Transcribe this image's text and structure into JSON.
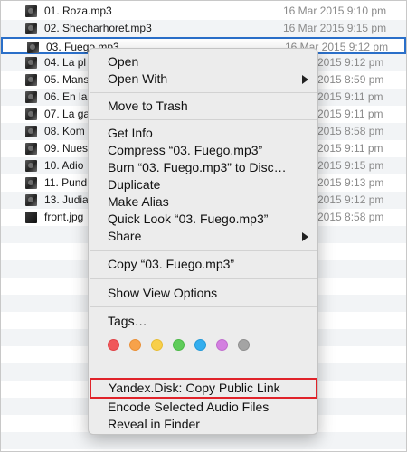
{
  "files": [
    {
      "name": "01. Roza.mp3",
      "date": "16 Mar 2015 9:10 pm",
      "icon": "audio-file-icon"
    },
    {
      "name": "02. Shecharhoret.mp3",
      "date": "16 Mar 2015 9:15 pm",
      "icon": "audio-file-icon"
    },
    {
      "name": "03. Fuego.mp3",
      "date": "16 Mar 2015 9:12 pm",
      "icon": "audio-file-icon"
    },
    {
      "name": "04. La pl",
      "date": "2015 9:12 pm",
      "icon": "audio-file-icon"
    },
    {
      "name": "05. Mans",
      "date": "2015 8:59 pm",
      "icon": "audio-file-icon"
    },
    {
      "name": "06. En la",
      "date": "2015 9:11 pm",
      "icon": "audio-file-icon"
    },
    {
      "name": "07. La ga",
      "date": "2015 9:11 pm",
      "icon": "audio-file-icon"
    },
    {
      "name": "08. Kom",
      "date": "2015 8:58 pm",
      "icon": "audio-file-icon"
    },
    {
      "name": "09. Nues",
      "date": "2015 9:11 pm",
      "icon": "audio-file-icon"
    },
    {
      "name": "10. Adio",
      "date": "2015 9:15 pm",
      "icon": "audio-file-icon"
    },
    {
      "name": "11. Pund",
      "date": "2015 9:13 pm",
      "icon": "audio-file-icon"
    },
    {
      "name": "13. Judia",
      "date": "2015 9:12 pm",
      "icon": "audio-file-icon"
    },
    {
      "name": "front.jpg",
      "date": "2015 8:58 pm",
      "icon": "image-file-icon"
    }
  ],
  "selected_index": 2,
  "menu": {
    "open": "Open",
    "open_with": "Open With",
    "move_to_trash": "Move to Trash",
    "get_info": "Get Info",
    "compress": "Compress “03. Fuego.mp3”",
    "burn": "Burn “03. Fuego.mp3” to Disc…",
    "duplicate": "Duplicate",
    "make_alias": "Make Alias",
    "quick_look": "Quick Look “03. Fuego.mp3”",
    "share": "Share",
    "copy": "Copy “03. Fuego.mp3”",
    "show_view_options": "Show View Options",
    "tags": "Tags…",
    "yandex_copy_link": "Yandex.Disk: Copy Public Link",
    "encode_audio": "Encode Selected Audio Files",
    "reveal_in_finder": "Reveal in Finder"
  },
  "tag_colors": [
    {
      "name": "red",
      "fill": "#f0575a",
      "border": "#e04448"
    },
    {
      "name": "orange",
      "fill": "#f7a24a",
      "border": "#ea9037"
    },
    {
      "name": "yellow",
      "fill": "#f8cf4a",
      "border": "#e8bd34"
    },
    {
      "name": "green",
      "fill": "#5fcc5a",
      "border": "#4cb948"
    },
    {
      "name": "blue",
      "fill": "#34aeee",
      "border": "#2399d8"
    },
    {
      "name": "purple",
      "fill": "#d37fe0",
      "border": "#c06bce"
    },
    {
      "name": "gray",
      "fill": "#a4a4a4",
      "border": "#8f8f8f"
    }
  ],
  "colors": {
    "selection_border": "#2a6fc9",
    "highlight_border": "#e0232a",
    "stripe": "#f2f4f6"
  }
}
